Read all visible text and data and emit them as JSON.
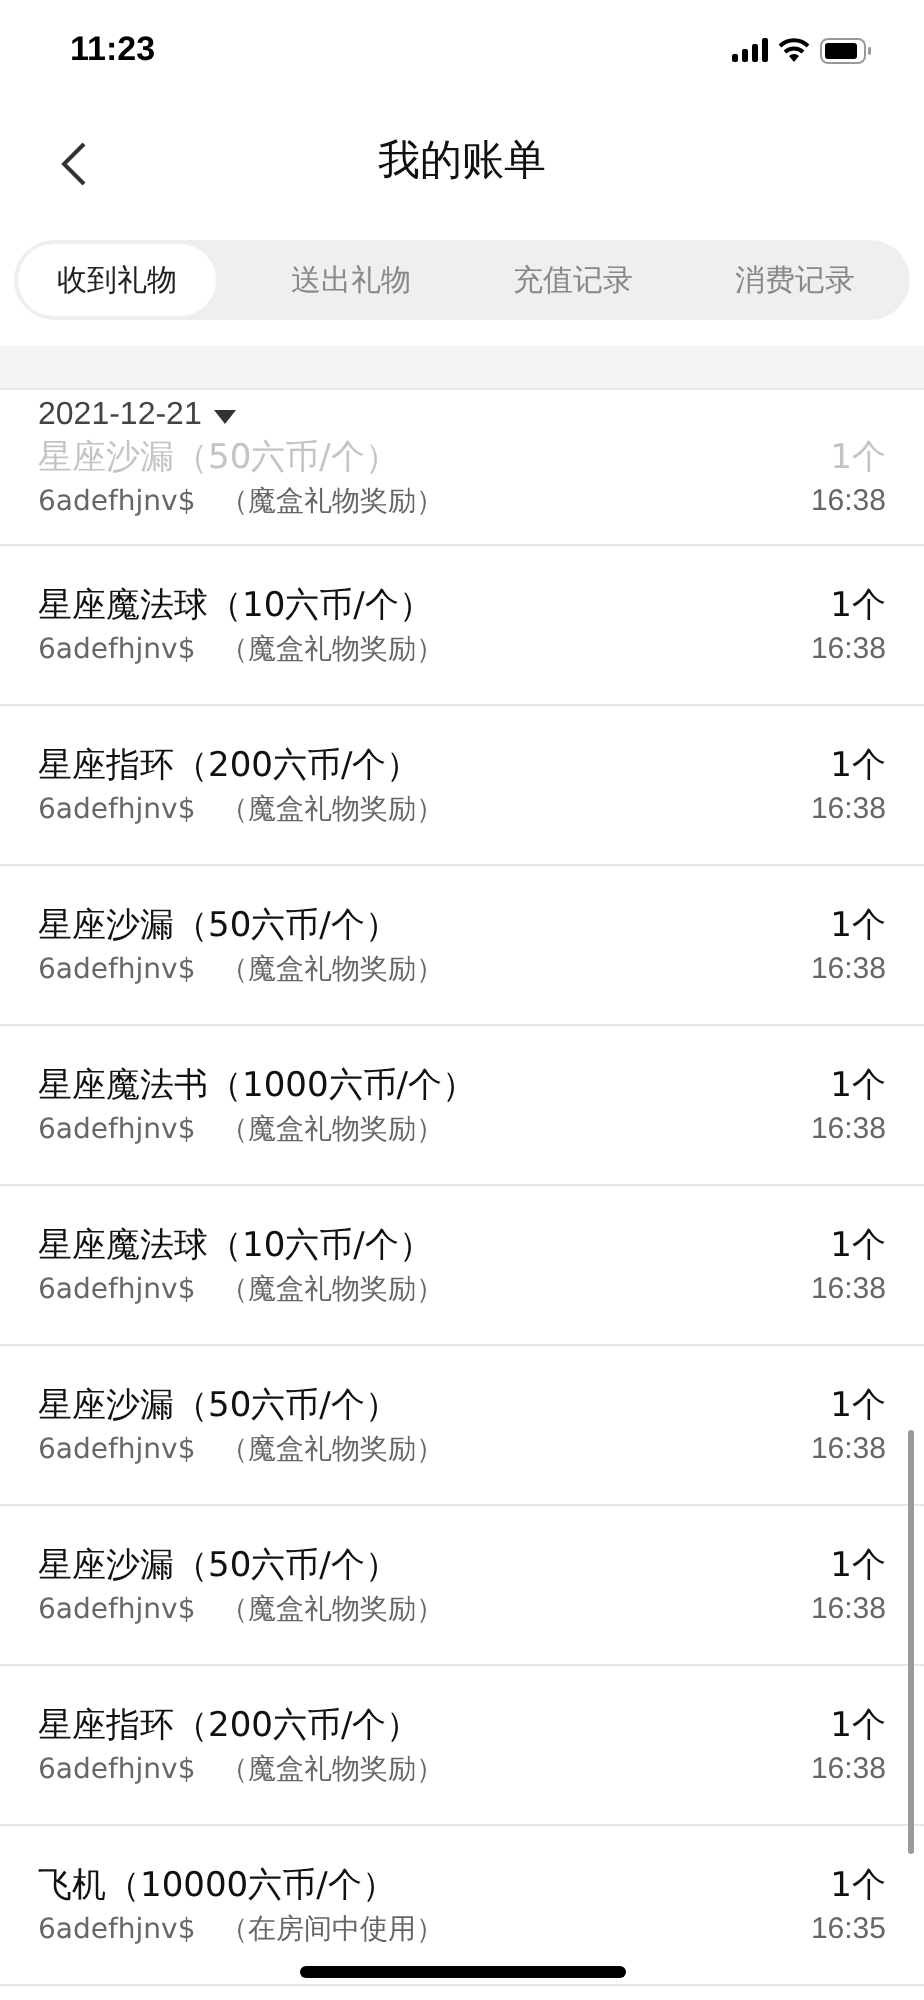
{
  "status_bar": {
    "time": "11:23"
  },
  "header": {
    "title": "我的账单"
  },
  "tabs": [
    {
      "label": "收到礼物",
      "selected": true
    },
    {
      "label": "送出礼物",
      "selected": false
    },
    {
      "label": "充值记录",
      "selected": false
    },
    {
      "label": "消费记录",
      "selected": false
    }
  ],
  "date_header": {
    "date": "2021-12-21"
  },
  "rows": [
    {
      "title": "星座沙漏（50六币/个）",
      "quantity": "1个",
      "user": "6adefhjnv$",
      "note": "（魔盒礼物奖励）",
      "time": "16:38",
      "dimmed": true
    },
    {
      "title": "星座魔法球（10六币/个）",
      "quantity": "1个",
      "user": "6adefhjnv$",
      "note": "（魔盒礼物奖励）",
      "time": "16:38",
      "dimmed": false
    },
    {
      "title": "星座指环（200六币/个）",
      "quantity": "1个",
      "user": "6adefhjnv$",
      "note": "（魔盒礼物奖励）",
      "time": "16:38",
      "dimmed": false
    },
    {
      "title": "星座沙漏（50六币/个）",
      "quantity": "1个",
      "user": "6adefhjnv$",
      "note": "（魔盒礼物奖励）",
      "time": "16:38",
      "dimmed": false
    },
    {
      "title": "星座魔法书（1000六币/个）",
      "quantity": "1个",
      "user": "6adefhjnv$",
      "note": "（魔盒礼物奖励）",
      "time": "16:38",
      "dimmed": false
    },
    {
      "title": "星座魔法球（10六币/个）",
      "quantity": "1个",
      "user": "6adefhjnv$",
      "note": "（魔盒礼物奖励）",
      "time": "16:38",
      "dimmed": false
    },
    {
      "title": "星座沙漏（50六币/个）",
      "quantity": "1个",
      "user": "6adefhjnv$",
      "note": "（魔盒礼物奖励）",
      "time": "16:38",
      "dimmed": false
    },
    {
      "title": "星座沙漏（50六币/个）",
      "quantity": "1个",
      "user": "6adefhjnv$",
      "note": "（魔盒礼物奖励）",
      "time": "16:38",
      "dimmed": false
    },
    {
      "title": "星座指环（200六币/个）",
      "quantity": "1个",
      "user": "6adefhjnv$",
      "note": "（魔盒礼物奖励）",
      "time": "16:38",
      "dimmed": false
    },
    {
      "title": "飞机（10000六币/个）",
      "quantity": "1个",
      "user": "6adefhjnv$",
      "note": "（在房间中使用）",
      "time": "16:35",
      "dimmed": false
    }
  ]
}
